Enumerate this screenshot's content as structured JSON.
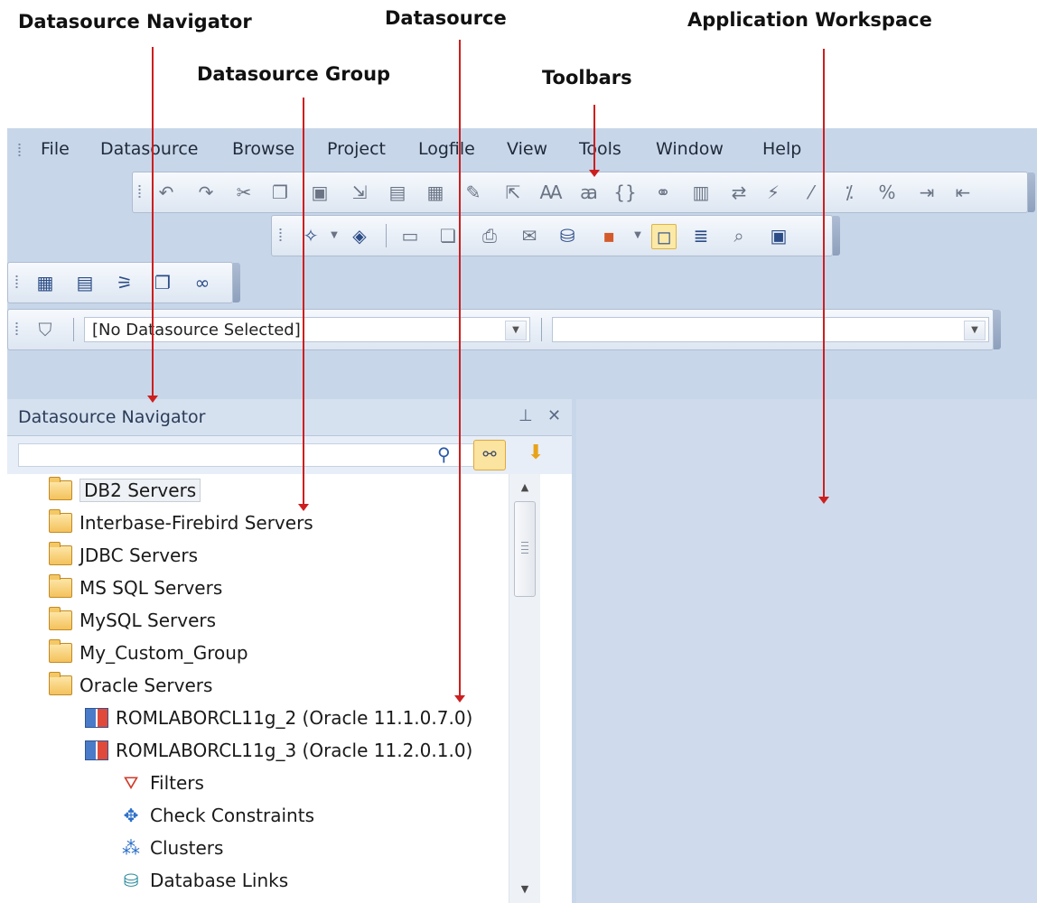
{
  "annotations": {
    "datasource_navigator": "Datasource Navigator",
    "datasource": "Datasource",
    "application_workspace": "Application Workspace",
    "datasource_group": "Datasource Group",
    "toolbars": "Toolbars"
  },
  "menu": {
    "items": [
      "File",
      "Datasource",
      "Browse",
      "Project",
      "Logfile",
      "View",
      "Tools",
      "Window",
      "Help"
    ]
  },
  "toolbar_icons": {
    "main": [
      "undo-icon",
      "redo-icon",
      "cut-icon",
      "copy-icon",
      "paste-icon",
      "import-icon",
      "sql-icon",
      "picture-icon",
      "edit-icon",
      "export-icon",
      "uppercase-icon",
      "lowercase-icon",
      "brace-icon",
      "binoculars-icon",
      "format-icon",
      "replace-icon",
      "lightning-icon",
      "comment-icon",
      "uncomment-icon",
      "toggle-comment-icon",
      "indent-icon",
      "outdent-icon"
    ],
    "secondary": [
      "new-script-icon",
      "open-icon",
      "save-icon",
      "save-all-icon",
      "print-icon",
      "mail-icon",
      "db-tool-icon",
      "layout-icon",
      "window-icon",
      "list-icon",
      "preview-icon",
      "console-icon"
    ],
    "navigator": [
      "table-icon",
      "list-view-icon",
      "hierarchy-icon",
      "clone-icon",
      "glasses-icon"
    ]
  },
  "datasource_selector": {
    "value": "[No Datasource Selected]",
    "secondary_value": ""
  },
  "navigator": {
    "title": "Datasource Navigator",
    "search_value": "",
    "tree": [
      {
        "label": "DB2 Servers",
        "icon": "folder-icon",
        "level": 0,
        "selected": true
      },
      {
        "label": "Interbase-Firebird Servers",
        "icon": "folder-icon",
        "level": 0
      },
      {
        "label": "JDBC Servers",
        "icon": "folder-icon",
        "level": 0
      },
      {
        "label": "MS SQL Servers",
        "icon": "folder-icon",
        "level": 0
      },
      {
        "label": "MySQL Servers",
        "icon": "folder-icon",
        "level": 0
      },
      {
        "label": "My_Custom_Group",
        "icon": "folder-icon",
        "level": 0
      },
      {
        "label": "Oracle Servers",
        "icon": "folder-icon",
        "level": 0
      },
      {
        "label": "ROMLABORCL11g_2 (Oracle 11.1.0.7.0)",
        "icon": "database-icon",
        "level": 1
      },
      {
        "label": "ROMLABORCL11g_3 (Oracle 11.2.0.1.0)",
        "icon": "database-icon",
        "level": 1
      },
      {
        "label": "Filters",
        "icon": "filter-icon",
        "level": 2
      },
      {
        "label": "Check Constraints",
        "icon": "check-constraint-icon",
        "level": 2
      },
      {
        "label": "Clusters",
        "icon": "clusters-icon",
        "level": 2
      },
      {
        "label": "Database Links",
        "icon": "database-link-icon",
        "level": 2
      }
    ]
  },
  "colors": {
    "frame": "#c8d6ea",
    "arrow": "#cc1f1f",
    "workspace": "#cfdbec"
  }
}
